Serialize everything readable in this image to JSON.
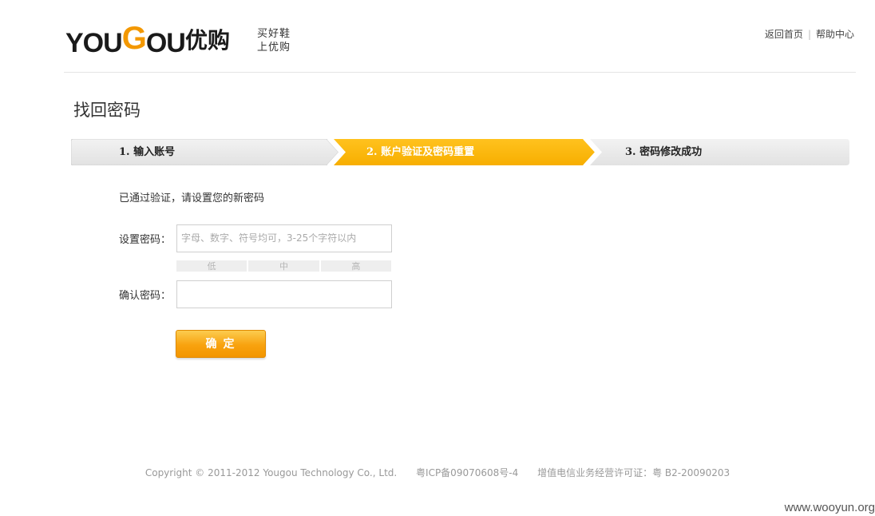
{
  "header": {
    "logo_text": "YOUGOU",
    "logo_cn": "优购",
    "slogan_line1": "买好鞋",
    "slogan_line2": "上优购",
    "link_home": "返回首页",
    "link_help": "帮助中心"
  },
  "page": {
    "title": "找回密码",
    "message": "已通过验证，请设置您的新密码"
  },
  "steps": [
    {
      "label": "1. 输入账号",
      "active": false
    },
    {
      "label": "2. 账户验证及密码重置",
      "active": true
    },
    {
      "label": "3. 密码修改成功",
      "active": false
    }
  ],
  "form": {
    "password_label": "设置密码：",
    "password_placeholder": "字母、数字、符号均可，3-25个字符以内",
    "strength_low": "低",
    "strength_mid": "中",
    "strength_high": "高",
    "confirm_label": "确认密码：",
    "confirm_value": "",
    "submit_label": "确定"
  },
  "footer": {
    "copyright": "Copyright © 2011-2012 Yougou Technology Co., Ltd.",
    "icp": "粤ICP备09070608号-4",
    "license": "增值电信业务经营许可证：粤 B2-20090203"
  },
  "watermark": "www.wooyun.org",
  "colors": {
    "accent": "#f9b000",
    "step_inactive": "#e8e8e8"
  }
}
